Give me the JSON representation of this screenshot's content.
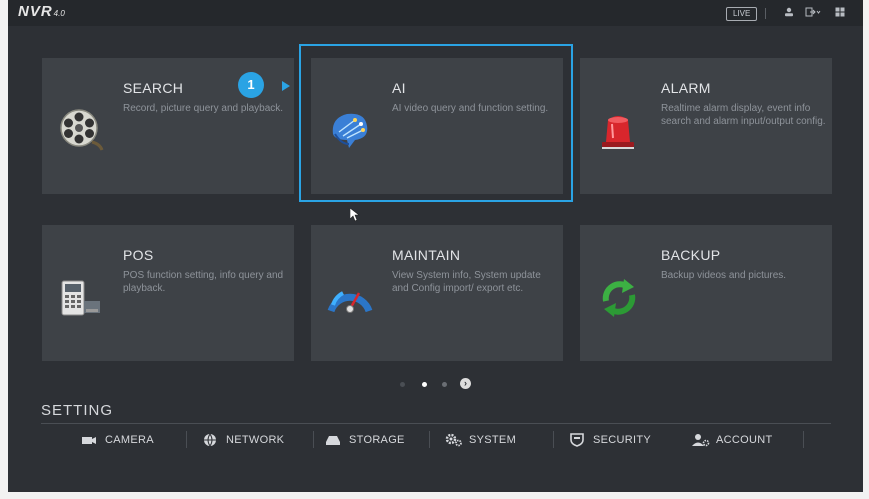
{
  "header": {
    "logo_text": "NVR",
    "logo_version": "4.0",
    "live_label": "LIVE"
  },
  "tiles": [
    {
      "title": "SEARCH",
      "desc": "Record, picture query and playback.",
      "icon": "film-reel-icon"
    },
    {
      "title": "AI",
      "desc": "AI video query and function setting.",
      "icon": "ai-brain-icon"
    },
    {
      "title": "ALARM",
      "desc": "Realtime alarm display, event info search and alarm input/output config.",
      "icon": "alarm-siren-icon"
    },
    {
      "title": "POS",
      "desc": "POS function setting, info query and playback.",
      "icon": "pos-terminal-icon"
    },
    {
      "title": "MAINTAIN",
      "desc": "View System info, System update and Config import/ export etc.",
      "icon": "gauge-icon"
    },
    {
      "title": "BACKUP",
      "desc": "Backup videos and pictures.",
      "icon": "sync-arrows-icon"
    }
  ],
  "annotation": {
    "step_number": "1",
    "highlight_color": "#2aa3e4"
  },
  "pagination": {
    "total_pages": 3,
    "current_page": 2
  },
  "setting": {
    "title": "SETTING",
    "items": [
      {
        "label": "CAMERA",
        "icon": "camera-icon"
      },
      {
        "label": "NETWORK",
        "icon": "network-globe-icon"
      },
      {
        "label": "STORAGE",
        "icon": "storage-drive-icon"
      },
      {
        "label": "SYSTEM",
        "icon": "gears-icon"
      },
      {
        "label": "SECURITY",
        "icon": "shield-icon"
      },
      {
        "label": "ACCOUNT",
        "icon": "user-gear-icon"
      }
    ]
  },
  "colors": {
    "background": "#2d3035",
    "tile": "#3e4247",
    "accent": "#2aa3e4"
  }
}
